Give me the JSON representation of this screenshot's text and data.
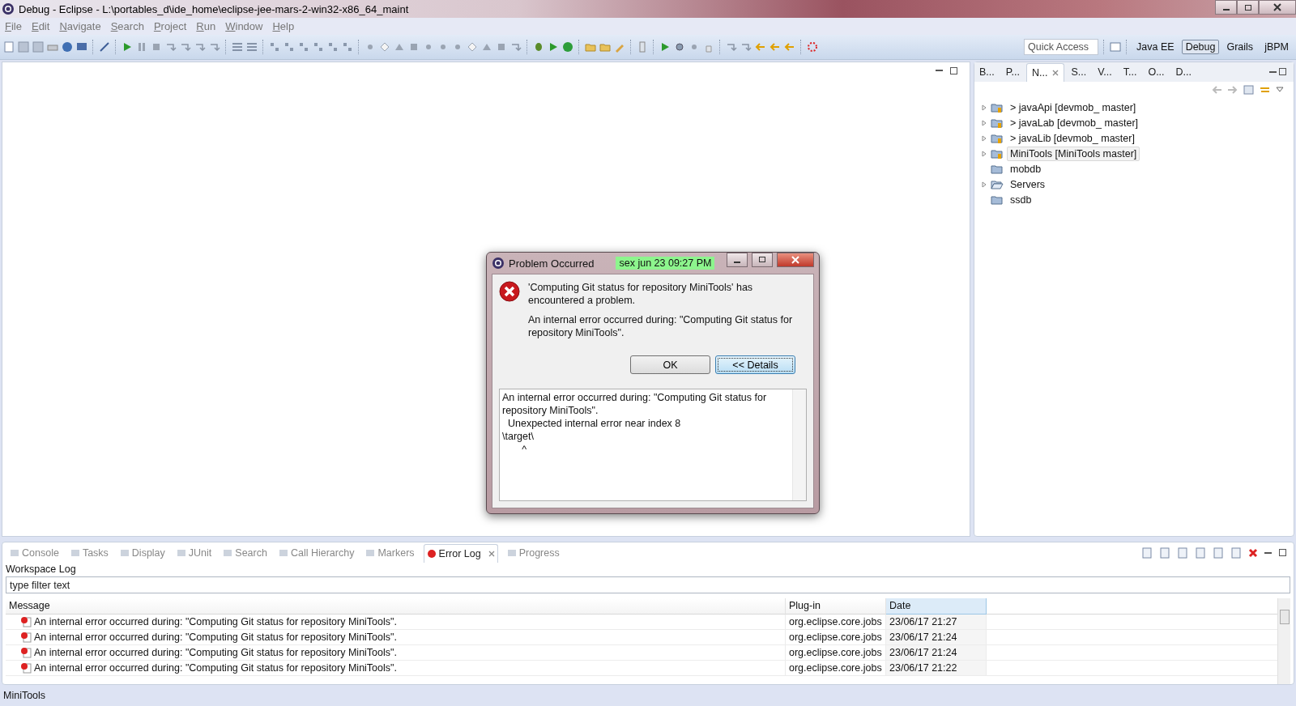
{
  "window": {
    "title": "Debug - Eclipse - L:\\portables_d\\ide_home\\eclipse-jee-mars-2-win32-x86_64_maint"
  },
  "menu": [
    "File",
    "Edit",
    "Navigate",
    "Search",
    "Project",
    "Run",
    "Window",
    "Help"
  ],
  "toolbar": {
    "quick_access": {
      "placeholder": "Quick Access"
    },
    "perspectives": [
      {
        "label": "Java EE",
        "selected": false
      },
      {
        "label": "Debug",
        "selected": true
      },
      {
        "label": "Grails",
        "selected": false
      },
      {
        "label": "jBPM",
        "selected": false
      }
    ]
  },
  "explorer": {
    "tabs": [
      {
        "label": "B...",
        "selected": false
      },
      {
        "label": "P...",
        "selected": false
      },
      {
        "label": "N...",
        "selected": true
      },
      {
        "label": "S...",
        "selected": false
      },
      {
        "label": "V...",
        "selected": false
      },
      {
        "label": "T...",
        "selected": false
      },
      {
        "label": "O...",
        "selected": false
      },
      {
        "label": "D...",
        "selected": false
      }
    ],
    "tree": [
      {
        "label": "> javaApi  [devmob_ master]",
        "expandable": true,
        "selected": false,
        "kind": "project"
      },
      {
        "label": "> javaLab  [devmob_ master]",
        "expandable": true,
        "selected": false,
        "kind": "project"
      },
      {
        "label": "> javaLib  [devmob_ master]",
        "expandable": true,
        "selected": false,
        "kind": "project"
      },
      {
        "label": "MiniTools  [MiniTools master]",
        "expandable": true,
        "selected": true,
        "kind": "project"
      },
      {
        "label": "mobdb",
        "expandable": false,
        "selected": false,
        "kind": "folder"
      },
      {
        "label": "Servers",
        "expandable": true,
        "selected": false,
        "kind": "open-folder"
      },
      {
        "label": "ssdb",
        "expandable": false,
        "selected": false,
        "kind": "folder"
      }
    ]
  },
  "bottom_panel": {
    "tabs": [
      {
        "label": "Console",
        "selected": false
      },
      {
        "label": "Tasks",
        "selected": false
      },
      {
        "label": "Display",
        "selected": false
      },
      {
        "label": "JUnit",
        "selected": false
      },
      {
        "label": "Search",
        "selected": false
      },
      {
        "label": "Call Hierarchy",
        "selected": false
      },
      {
        "label": "Markers",
        "selected": false
      },
      {
        "label": "Error Log",
        "selected": true
      },
      {
        "label": "Progress",
        "selected": false
      }
    ],
    "heading": "Workspace Log",
    "filter": {
      "placeholder": "type filter text"
    },
    "table": {
      "columns": [
        {
          "label": "Message",
          "sorted": false
        },
        {
          "label": "Plug-in",
          "sorted": false
        },
        {
          "label": "Date",
          "sorted": true
        }
      ],
      "rows": [
        [
          "An internal error occurred during: \"Computing Git status for repository MiniTools\".",
          "org.eclipse.core.jobs",
          "23/06/17 21:27"
        ],
        [
          "An internal error occurred during: \"Computing Git status for repository MiniTools\".",
          "org.eclipse.core.jobs",
          "23/06/17 21:24"
        ],
        [
          "An internal error occurred during: \"Computing Git status for repository MiniTools\".",
          "org.eclipse.core.jobs",
          "23/06/17 21:24"
        ],
        [
          "An internal error occurred during: \"Computing Git status for repository MiniTools\".",
          "org.eclipse.core.jobs",
          "23/06/17 21:22"
        ]
      ]
    }
  },
  "status_bar": "MiniTools",
  "dialog": {
    "title": "Problem Occurred",
    "clock": "sex  jun  23  09:27 PM",
    "message": "'Computing Git status for repository MiniTools' has encountered a problem.",
    "detail": "An internal error occurred during: \"Computing Git status for repository MiniTools\".",
    "buttons": [
      {
        "label": "OK",
        "default": false
      },
      {
        "label": "<< Details",
        "default": true
      }
    ],
    "details_text": "An internal error occurred during: \"Computing Git status for repository MiniTools\".\n  Unexpected internal error near index 8\n\\target\\\n       ^"
  }
}
